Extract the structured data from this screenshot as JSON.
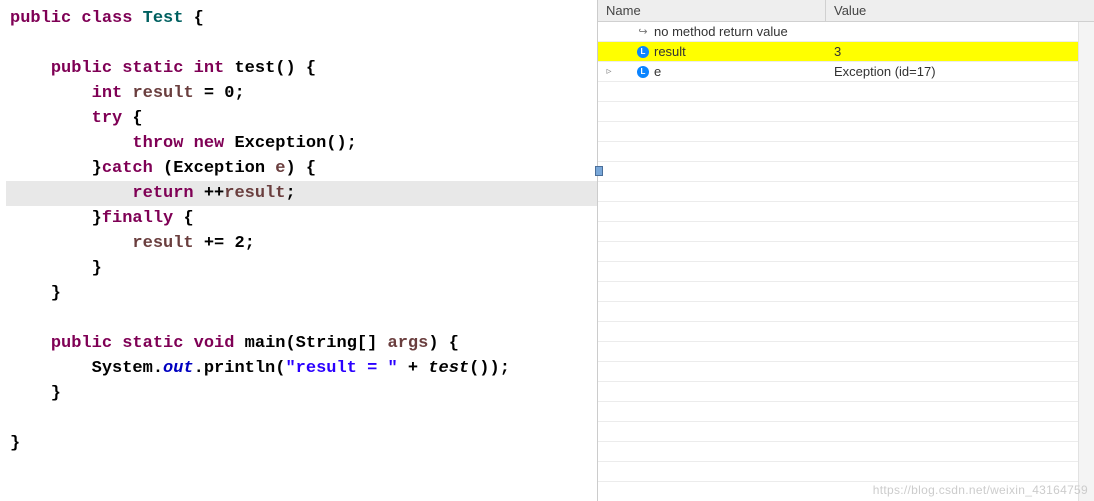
{
  "editor": {
    "highlight_line_index": 8,
    "lines": [
      {
        "tokens": [
          {
            "t": "public",
            "c": "kw"
          },
          {
            "t": " ",
            "c": "pln"
          },
          {
            "t": "class",
            "c": "kw"
          },
          {
            "t": " ",
            "c": "pln"
          },
          {
            "t": "Test",
            "c": "cls"
          },
          {
            "t": " {",
            "c": "pln"
          }
        ]
      },
      {
        "tokens": []
      },
      {
        "tokens": [
          {
            "t": "    ",
            "c": "pln"
          },
          {
            "t": "public",
            "c": "kw"
          },
          {
            "t": " ",
            "c": "pln"
          },
          {
            "t": "static",
            "c": "kw"
          },
          {
            "t": " ",
            "c": "pln"
          },
          {
            "t": "int",
            "c": "kw"
          },
          {
            "t": " ",
            "c": "pln"
          },
          {
            "t": "test",
            "c": "mtd"
          },
          {
            "t": "() {",
            "c": "pln"
          }
        ]
      },
      {
        "tokens": [
          {
            "t": "        ",
            "c": "pln"
          },
          {
            "t": "int",
            "c": "kw"
          },
          {
            "t": " ",
            "c": "pln"
          },
          {
            "t": "result",
            "c": "var"
          },
          {
            "t": " = ",
            "c": "pln"
          },
          {
            "t": "0",
            "c": "num"
          },
          {
            "t": ";",
            "c": "pln"
          }
        ]
      },
      {
        "tokens": [
          {
            "t": "        ",
            "c": "pln"
          },
          {
            "t": "try",
            "c": "kw"
          },
          {
            "t": " {",
            "c": "pln"
          }
        ]
      },
      {
        "tokens": [
          {
            "t": "            ",
            "c": "pln"
          },
          {
            "t": "throw",
            "c": "kw"
          },
          {
            "t": " ",
            "c": "pln"
          },
          {
            "t": "new",
            "c": "kw"
          },
          {
            "t": " Exception();",
            "c": "pln"
          }
        ]
      },
      {
        "tokens": [
          {
            "t": "        }",
            "c": "pln"
          },
          {
            "t": "catch",
            "c": "kw"
          },
          {
            "t": " (Exception ",
            "c": "pln"
          },
          {
            "t": "e",
            "c": "var"
          },
          {
            "t": ") {",
            "c": "pln"
          }
        ]
      },
      {
        "tokens": [
          {
            "t": "            ",
            "c": "pln"
          },
          {
            "t": "return",
            "c": "kw"
          },
          {
            "t": " ++",
            "c": "pln"
          },
          {
            "t": "result",
            "c": "var"
          },
          {
            "t": ";",
            "c": "pln"
          }
        ]
      },
      {
        "tokens": [
          {
            "t": "        }",
            "c": "pln"
          },
          {
            "t": "finally",
            "c": "kw"
          },
          {
            "t": " {",
            "c": "pln"
          }
        ]
      },
      {
        "tokens": [
          {
            "t": "            ",
            "c": "pln"
          },
          {
            "t": "result",
            "c": "var"
          },
          {
            "t": " += 2;",
            "c": "pln"
          }
        ]
      },
      {
        "tokens": [
          {
            "t": "        }",
            "c": "pln"
          }
        ]
      },
      {
        "tokens": [
          {
            "t": "    }",
            "c": "pln"
          }
        ]
      },
      {
        "tokens": []
      },
      {
        "tokens": [
          {
            "t": "    ",
            "c": "pln"
          },
          {
            "t": "public",
            "c": "kw"
          },
          {
            "t": " ",
            "c": "pln"
          },
          {
            "t": "static",
            "c": "kw"
          },
          {
            "t": " ",
            "c": "pln"
          },
          {
            "t": "void",
            "c": "kw"
          },
          {
            "t": " ",
            "c": "pln"
          },
          {
            "t": "main",
            "c": "mtd"
          },
          {
            "t": "(String[] ",
            "c": "pln"
          },
          {
            "t": "args",
            "c": "var"
          },
          {
            "t": ") {",
            "c": "pln"
          }
        ]
      },
      {
        "tokens": [
          {
            "t": "        System.",
            "c": "pln"
          },
          {
            "t": "out",
            "c": "stat"
          },
          {
            "t": ".println(",
            "c": "pln"
          },
          {
            "t": "\"result = \"",
            "c": "str"
          },
          {
            "t": " + ",
            "c": "pln"
          },
          {
            "t": "test",
            "c": "call"
          },
          {
            "t": "());",
            "c": "pln"
          }
        ]
      },
      {
        "tokens": [
          {
            "t": "    }",
            "c": "pln"
          }
        ]
      },
      {
        "tokens": []
      },
      {
        "tokens": [
          {
            "t": "}",
            "c": "pln"
          }
        ]
      }
    ]
  },
  "variables_panel": {
    "columns": {
      "name": "Name",
      "value": "Value"
    },
    "rows": [
      {
        "icon": "return",
        "expand": "none",
        "highlight": false,
        "indent": 1,
        "name": "no method return value",
        "value": ""
      },
      {
        "icon": "field",
        "expand": "none",
        "highlight": true,
        "indent": 1,
        "name": "result",
        "value": "3"
      },
      {
        "icon": "field",
        "expand": "closed",
        "highlight": false,
        "indent": 1,
        "name": "e",
        "value": "Exception  (id=17)"
      }
    ],
    "empty_rows": 21
  },
  "watermark": "https://blog.csdn.net/weixin_43164759"
}
